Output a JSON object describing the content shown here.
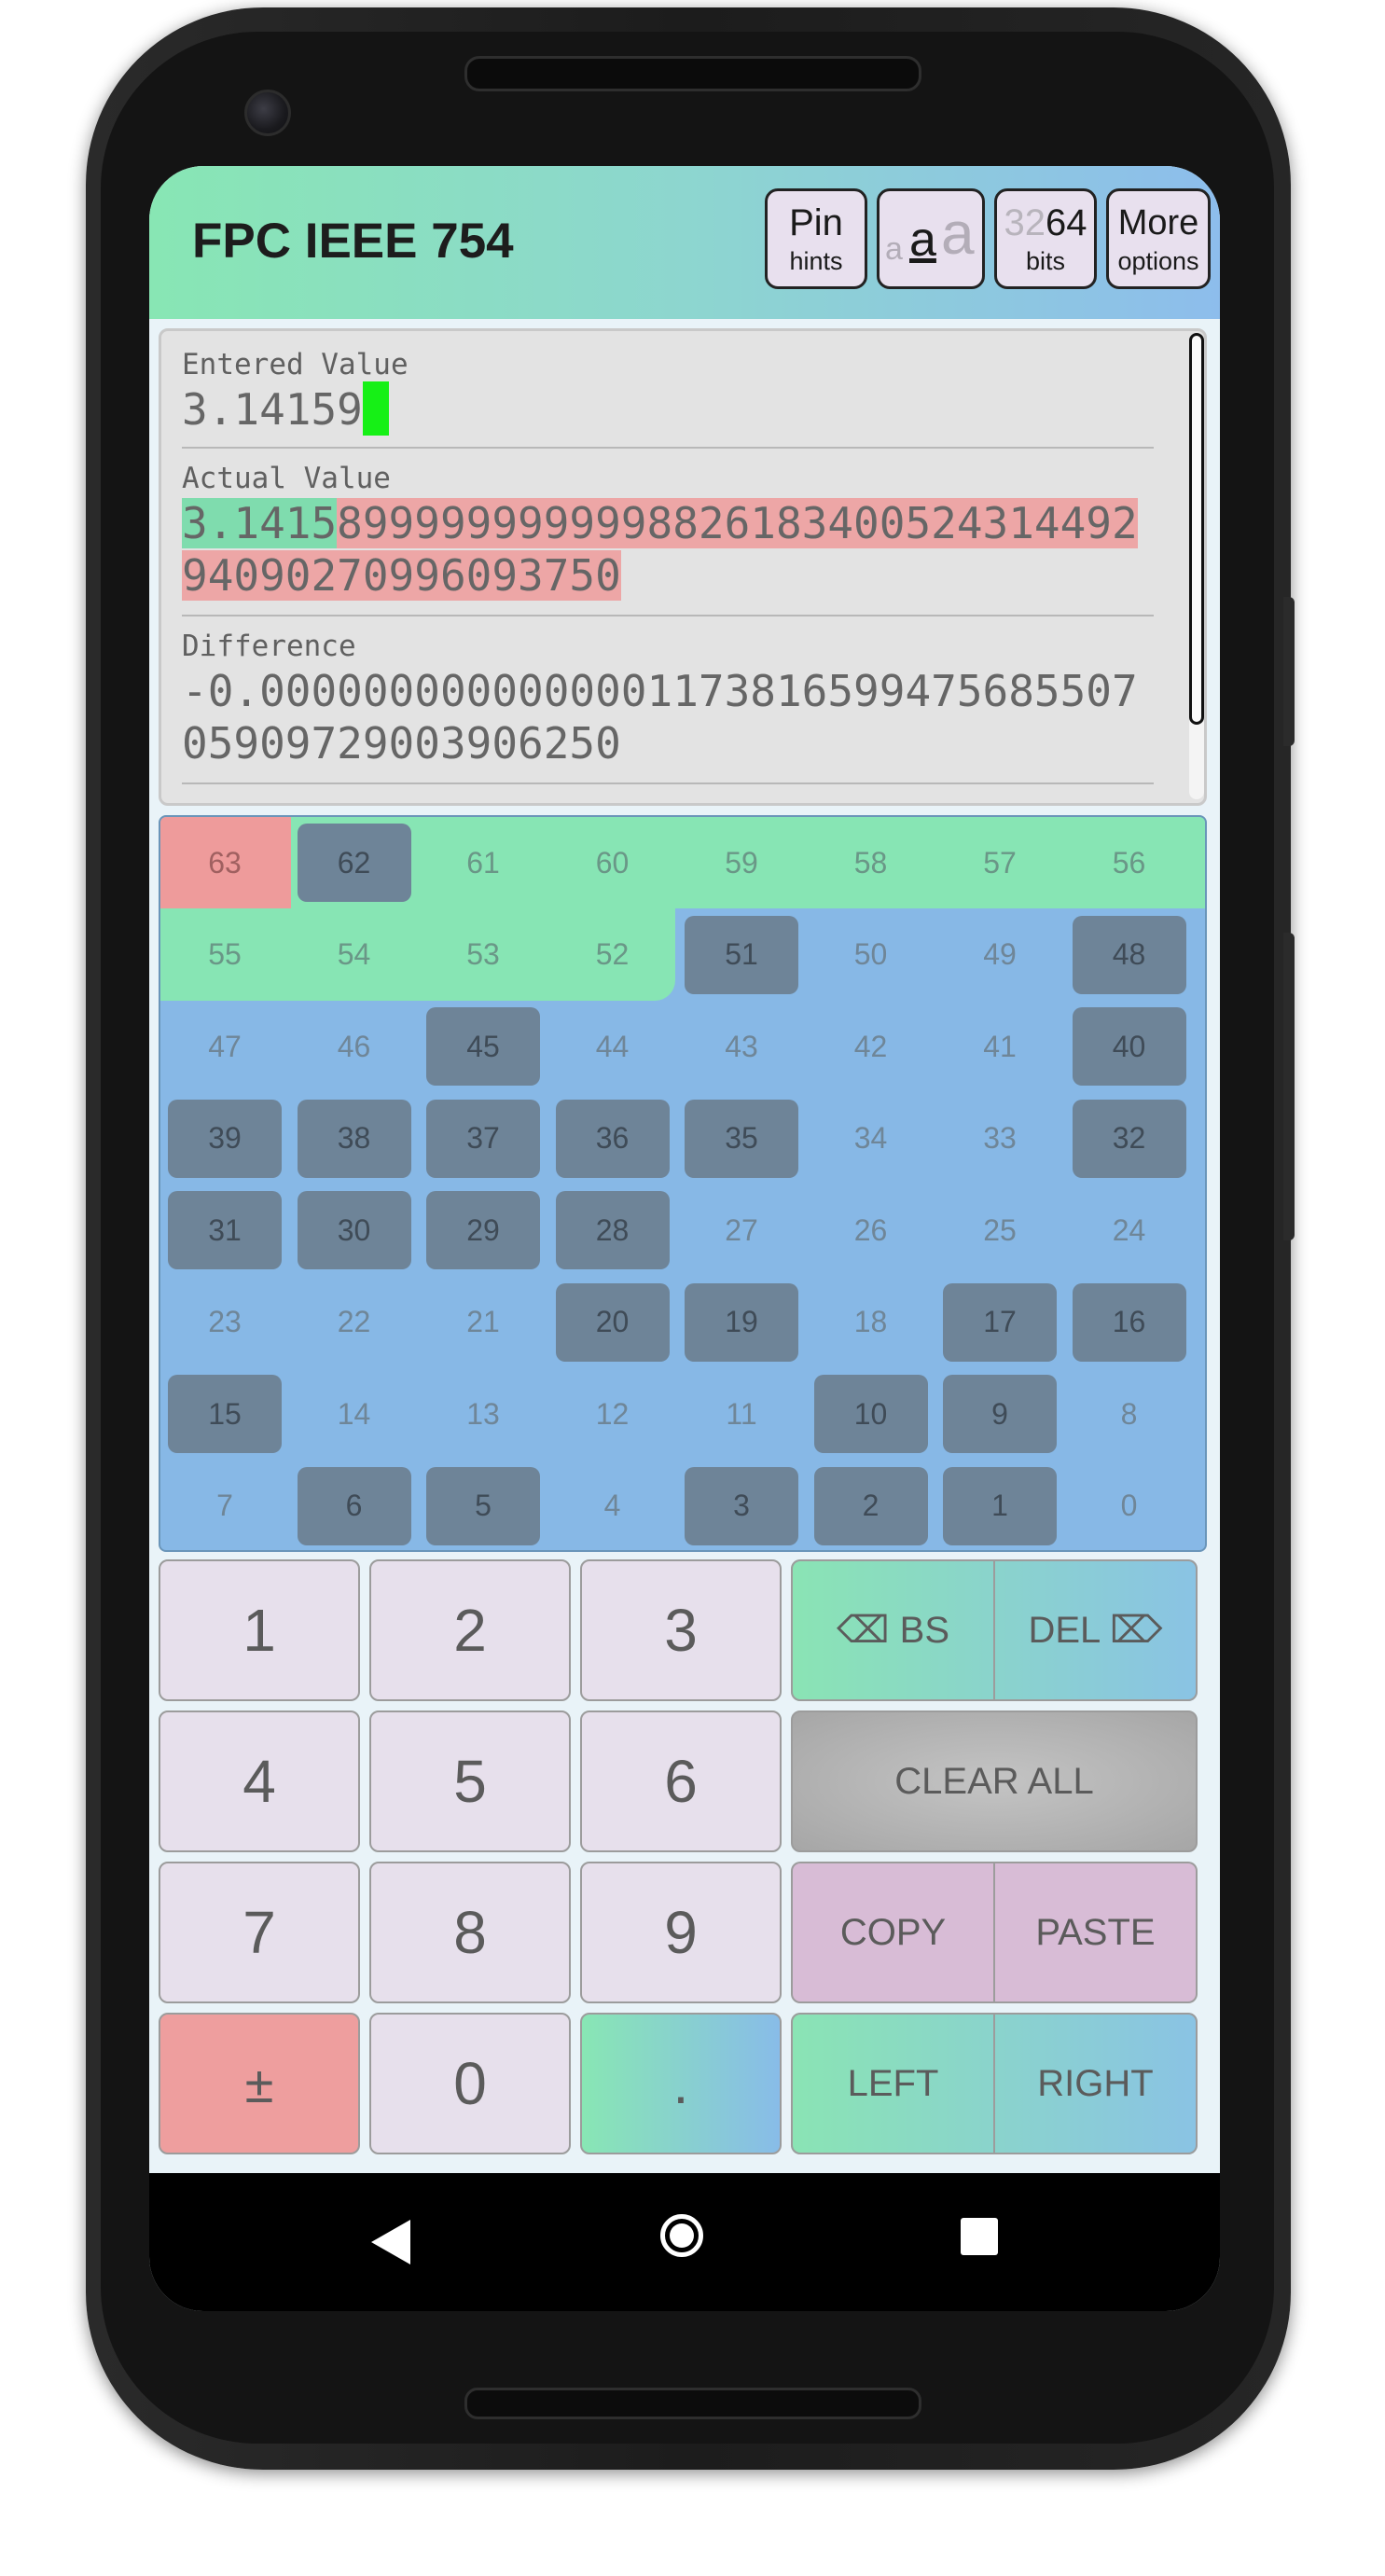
{
  "app": {
    "title": "FPC IEEE 754",
    "pin_hints": {
      "top": "Pin",
      "bottom": "hints"
    },
    "text_size": {
      "small": "a",
      "medium": "a",
      "large": "a"
    },
    "bits": {
      "prefix": "32",
      "value": "64",
      "label": "bits"
    },
    "more_options": {
      "top": "More",
      "bottom": "options"
    }
  },
  "value_display": {
    "entered_label": "Entered Value",
    "entered_value": "3.14159",
    "actual_label": "Actual Value",
    "actual_value_matched": "3.1415",
    "actual_value_rest": "899999999999882618340052431449294090270996093750",
    "difference_label": "Difference",
    "difference_value": "-0.000000000000000117381659947568550705909729003906250"
  },
  "bits": {
    "labels": [
      "63",
      "62",
      "61",
      "60",
      "59",
      "58",
      "57",
      "56",
      "55",
      "54",
      "53",
      "52",
      "51",
      "50",
      "49",
      "48",
      "47",
      "46",
      "45",
      "44",
      "43",
      "42",
      "41",
      "40",
      "39",
      "38",
      "37",
      "36",
      "35",
      "34",
      "33",
      "32",
      "31",
      "30",
      "29",
      "28",
      "27",
      "26",
      "25",
      "24",
      "23",
      "22",
      "21",
      "20",
      "19",
      "18",
      "17",
      "16",
      "15",
      "14",
      "13",
      "12",
      "11",
      "10",
      "9",
      "8",
      "7",
      "6",
      "5",
      "4",
      "3",
      "2",
      "1",
      "0"
    ],
    "set": [
      62,
      51,
      48,
      45,
      40,
      39,
      38,
      37,
      36,
      35,
      32,
      31,
      30,
      29,
      28,
      20,
      19,
      17,
      16,
      15,
      10,
      9,
      6,
      5,
      3,
      2,
      1
    ],
    "sign_bits": [
      63
    ],
    "exponent_bits": [
      62,
      61,
      60,
      59,
      58,
      57,
      56,
      55,
      54,
      53,
      52
    ],
    "colors": {
      "sign": "#ee9b9b",
      "exponent": "#87e5b4",
      "mantissa": "#87b8e6",
      "set_bit": "#6e8498"
    }
  },
  "keypad": {
    "k1": "1",
    "k2": "2",
    "k3": "3",
    "k4": "4",
    "k5": "5",
    "k6": "6",
    "k7": "7",
    "k8": "8",
    "k9": "9",
    "k0": "0",
    "sign": "±",
    "decimal": ".",
    "backspace": "⌫ BS",
    "delete": "DEL ⌦",
    "clear_all": "CLEAR ALL",
    "copy": "COPY",
    "paste": "PASTE",
    "left": "LEFT",
    "right": "RIGHT"
  },
  "nav": {
    "back_icon": "triangle-back-icon",
    "home_icon": "circle-home-icon",
    "recents_icon": "square-recents-icon"
  }
}
